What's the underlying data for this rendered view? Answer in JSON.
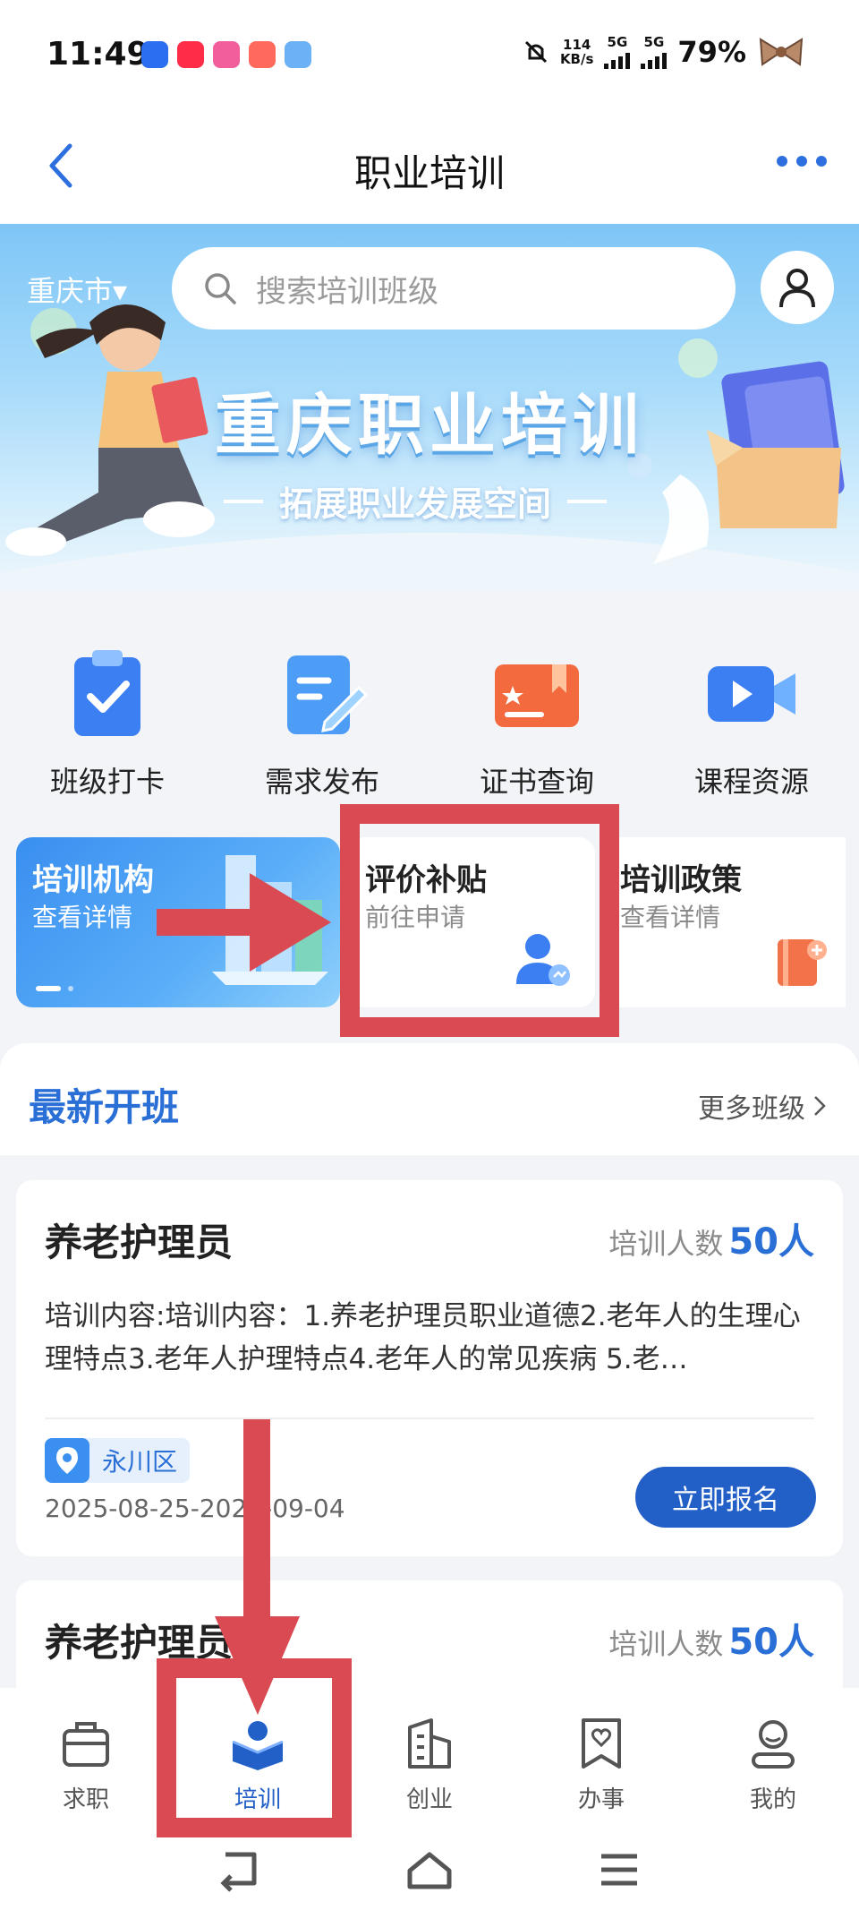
{
  "status_bar": {
    "time": "11:49",
    "net_speed_value": "114",
    "net_speed_unit": "KB/s",
    "sim1_label": "5G",
    "sim2_label": "5G",
    "battery": "79%"
  },
  "header": {
    "title": "职业培训"
  },
  "banner": {
    "city": "重庆市▾",
    "search_placeholder": "搜索培训班级",
    "title": "重庆职业培训",
    "subtitle": "拓展职业发展空间"
  },
  "quick_actions": [
    {
      "label": "班级打卡",
      "icon": "clipboard-check-icon"
    },
    {
      "label": "需求发布",
      "icon": "edit-note-icon"
    },
    {
      "label": "证书查询",
      "icon": "certificate-icon"
    },
    {
      "label": "课程资源",
      "icon": "video-camera-icon"
    }
  ],
  "service_cards": [
    {
      "title": "培训机构",
      "subtitle": "查看详情"
    },
    {
      "title": "评价补贴",
      "subtitle": "前往申请"
    },
    {
      "title": "培训政策",
      "subtitle": "查看详情"
    }
  ],
  "latest": {
    "title": "最新开班",
    "more": "更多班级"
  },
  "classes": [
    {
      "title": "养老护理员",
      "count_label": "培训人数",
      "count_value": "50人",
      "description": "培训内容:培训内容：1.养老护理员职业道德2.老年人的生理心理特点3.老年人护理特点4.老年人的常见疾病 5.老…",
      "location": "永川区",
      "date": "2025-08-25-2025-09-04",
      "action": "立即报名"
    },
    {
      "title": "养老护理员",
      "count_label": "培训人数",
      "count_value": "50人"
    }
  ],
  "tabs": [
    {
      "label": "求职",
      "icon": "briefcase-icon"
    },
    {
      "label": "培训",
      "icon": "training-book-icon"
    },
    {
      "label": "创业",
      "icon": "building-icon"
    },
    {
      "label": "办事",
      "icon": "heart-bookmark-icon"
    },
    {
      "label": "我的",
      "icon": "user-icon"
    }
  ],
  "colors": {
    "primary": "#2260c8",
    "accent_blue": "#2a6fd6",
    "annotation_red": "#d94a52"
  }
}
